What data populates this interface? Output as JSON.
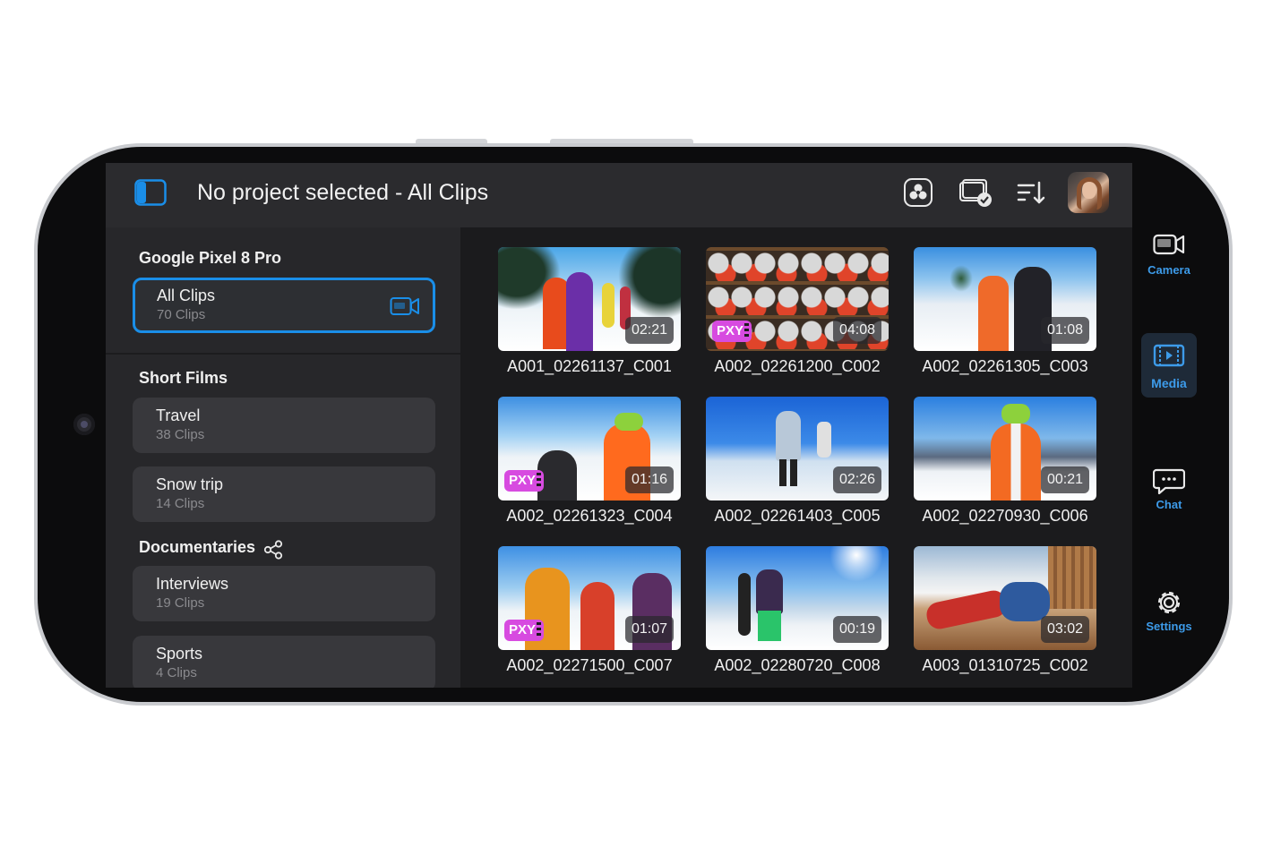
{
  "header": {
    "title": "No project selected - All Clips",
    "icons": [
      "sidebar-toggle-icon",
      "resolve-logo-icon",
      "clip-select-icon",
      "sort-icon",
      "user-avatar"
    ]
  },
  "sidebar": {
    "device_title": "Google Pixel 8 Pro",
    "all_clips": {
      "label": "All Clips",
      "count": "70 Clips"
    },
    "short_films_title": "Short Films",
    "short_films": [
      {
        "label": "Travel",
        "count": "38 Clips"
      },
      {
        "label": "Snow trip",
        "count": "14 Clips"
      }
    ],
    "documentaries_title": "Documentaries",
    "documentaries": [
      {
        "label": "Interviews",
        "count": "19 Clips"
      },
      {
        "label": "Sports",
        "count": "4 Clips"
      }
    ]
  },
  "clips": [
    {
      "name": "A001_02261137_C001",
      "duration": "02:21",
      "pxy": false
    },
    {
      "name": "A002_02261200_C002",
      "duration": "04:08",
      "pxy": true
    },
    {
      "name": "A002_02261305_C003",
      "duration": "01:08",
      "pxy": false
    },
    {
      "name": "A002_02261323_C004",
      "duration": "01:16",
      "pxy": true
    },
    {
      "name": "A002_02261403_C005",
      "duration": "02:26",
      "pxy": false
    },
    {
      "name": "A002_02270930_C006",
      "duration": "00:21",
      "pxy": false
    },
    {
      "name": "A002_02271500_C007",
      "duration": "01:07",
      "pxy": true
    },
    {
      "name": "A002_02280720_C008",
      "duration": "00:19",
      "pxy": false
    },
    {
      "name": "A003_01310725_C002",
      "duration": "03:02",
      "pxy": false
    }
  ],
  "pxy_badge": "PXY",
  "nav": {
    "camera": "Camera",
    "media": "Media",
    "chat": "Chat",
    "settings": "Settings",
    "active": "media"
  },
  "colors": {
    "accent": "#1a8ee8",
    "nav_accent": "#3d9be9",
    "pxy_badge": "#d74be0",
    "background": "#232325"
  }
}
